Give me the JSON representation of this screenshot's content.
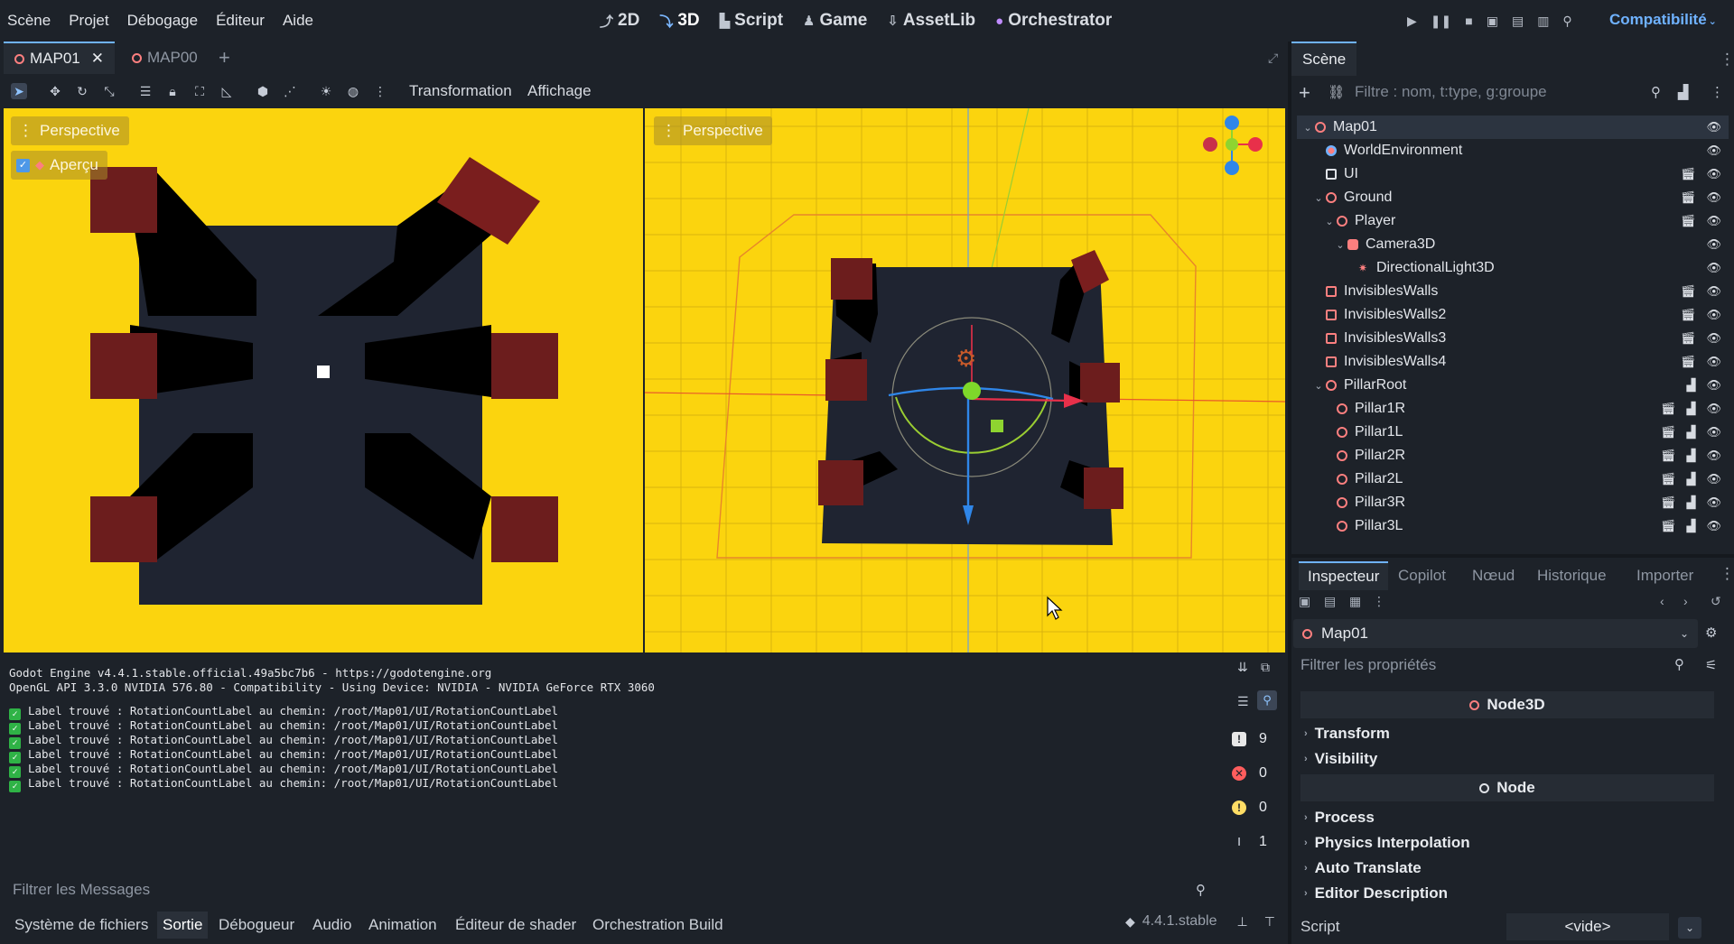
{
  "menu": [
    "Scène",
    "Projet",
    "Débogage",
    "Éditeur",
    "Aide"
  ],
  "workspaces": [
    {
      "label": "2D",
      "icon": "2d-icon"
    },
    {
      "label": "3D",
      "icon": "3d-icon"
    },
    {
      "label": "Script",
      "icon": "script-icon"
    },
    {
      "label": "Game",
      "icon": "game-icon"
    },
    {
      "label": "AssetLib",
      "icon": "assetlib-icon"
    },
    {
      "label": "Orchestrator",
      "icon": "orchestrator-icon"
    }
  ],
  "active_workspace": "3D",
  "renderer": "Compatibilité",
  "editor_tabs": [
    {
      "label": "MAP01",
      "active": true
    },
    {
      "label": "MAP00",
      "active": false
    }
  ],
  "viewport_toolbar": {
    "transform_label": "Transformation",
    "view_label": "Affichage"
  },
  "viewports": {
    "left": {
      "mode": "Perspective",
      "preview_label": "Aperçu",
      "preview_checked": true
    },
    "right": {
      "mode": "Perspective"
    }
  },
  "output": {
    "lines": [
      "Godot Engine v4.4.1.stable.official.49a5bc7b6 - https://godotengine.org",
      "OpenGL API 3.3.0 NVIDIA 576.80 - Compatibility - Using Device: NVIDIA - NVIDIA GeForce RTX 3060"
    ],
    "label_lines": [
      "Label trouvé : RotationCountLabel au chemin: /root/Map01/UI/RotationCountLabel",
      "Label trouvé : RotationCountLabel au chemin: /root/Map01/UI/RotationCountLabel",
      "Label trouvé : RotationCountLabel au chemin: /root/Map01/UI/RotationCountLabel",
      "Label trouvé : RotationCountLabel au chemin: /root/Map01/UI/RotationCountLabel",
      "Label trouvé : RotationCountLabel au chemin: /root/Map01/UI/RotationCountLabel",
      "Label trouvé : RotationCountLabel au chemin: /root/Map01/UI/RotationCountLabel"
    ],
    "counts": {
      "messages": "9",
      "errors": "0",
      "warnings": "0",
      "editor": "1"
    },
    "filter_placeholder": "Filtrer les Messages"
  },
  "bottom_tabs": [
    "Système de fichiers",
    "Sortie",
    "Débogueur",
    "Audio",
    "Animation",
    "Éditeur de shader",
    "Orchestration Build"
  ],
  "active_bottom_tab": "Sortie",
  "version": "4.4.1.stable",
  "scene_dock": {
    "title": "Scène",
    "filter_placeholder": "Filtre : nom, t:type, g:groupe",
    "nodes": [
      {
        "name": "Map01",
        "depth": 0,
        "arrow": "v",
        "icon": "node3d-icon",
        "color": "#fc7f7f",
        "extra": []
      },
      {
        "name": "WorldEnvironment",
        "depth": 1,
        "arrow": "",
        "icon": "world-environment-icon",
        "color": "#fc7f7f",
        "extra": []
      },
      {
        "name": "UI",
        "depth": 1,
        "arrow": "",
        "icon": "control-icon",
        "color": "#8eef97",
        "extra": [
          "clapper-icon"
        ]
      },
      {
        "name": "Ground",
        "depth": 1,
        "arrow": "v",
        "icon": "node3d-icon",
        "color": "#fc7f7f",
        "extra": [
          "clapper-icon"
        ]
      },
      {
        "name": "Player",
        "depth": 2,
        "arrow": "v",
        "icon": "node3d-icon",
        "color": "#fc7f7f",
        "extra": [
          "clapper-icon"
        ]
      },
      {
        "name": "Camera3D",
        "depth": 3,
        "arrow": "v",
        "icon": "camera3d-icon",
        "color": "#fc7f7f",
        "extra": []
      },
      {
        "name": "DirectionalLight3D",
        "depth": 4,
        "arrow": "",
        "icon": "light-icon",
        "color": "#fc7f7f",
        "extra": []
      },
      {
        "name": "InvisiblesWalls",
        "depth": 1,
        "arrow": "",
        "icon": "staticbody-icon",
        "color": "#fc7f7f",
        "extra": [
          "clapper-icon"
        ]
      },
      {
        "name": "InvisiblesWalls2",
        "depth": 1,
        "arrow": "",
        "icon": "staticbody-icon",
        "color": "#fc7f7f",
        "extra": [
          "clapper-icon"
        ]
      },
      {
        "name": "InvisiblesWalls3",
        "depth": 1,
        "arrow": "",
        "icon": "staticbody-icon",
        "color": "#fc7f7f",
        "extra": [
          "clapper-icon"
        ]
      },
      {
        "name": "InvisiblesWalls4",
        "depth": 1,
        "arrow": "",
        "icon": "staticbody-icon",
        "color": "#fc7f7f",
        "extra": [
          "clapper-icon"
        ]
      },
      {
        "name": "PillarRoot",
        "depth": 1,
        "arrow": "v",
        "icon": "node3d-icon",
        "color": "#fc7f7f",
        "extra": [
          "script-icon"
        ]
      },
      {
        "name": "Pillar1R",
        "depth": 2,
        "arrow": "",
        "icon": "node3d-icon",
        "color": "#fc7f7f",
        "extra": [
          "clapper-icon",
          "script-icon"
        ]
      },
      {
        "name": "Pillar1L",
        "depth": 2,
        "arrow": "",
        "icon": "node3d-icon",
        "color": "#fc7f7f",
        "extra": [
          "clapper-icon",
          "script-icon"
        ]
      },
      {
        "name": "Pillar2R",
        "depth": 2,
        "arrow": "",
        "icon": "node3d-icon",
        "color": "#fc7f7f",
        "extra": [
          "clapper-icon",
          "script-icon"
        ]
      },
      {
        "name": "Pillar2L",
        "depth": 2,
        "arrow": "",
        "icon": "node3d-icon",
        "color": "#fc7f7f",
        "extra": [
          "clapper-icon",
          "script-icon"
        ]
      },
      {
        "name": "Pillar3R",
        "depth": 2,
        "arrow": "",
        "icon": "node3d-icon",
        "color": "#fc7f7f",
        "extra": [
          "clapper-icon",
          "script-icon"
        ]
      },
      {
        "name": "Pillar3L",
        "depth": 2,
        "arrow": "",
        "icon": "node3d-icon",
        "color": "#fc7f7f",
        "extra": [
          "clapper-icon",
          "script-icon"
        ]
      }
    ]
  },
  "inspector": {
    "tabs": [
      "Inspecteur",
      "Copilot",
      "Nœud",
      "Historique",
      "Importer"
    ],
    "active_tab": "Inspecteur",
    "object": "Map01",
    "filter_placeholder": "Filtrer les propriétés",
    "class1": "Node3D",
    "sections1": [
      "Transform",
      "Visibility"
    ],
    "class2": "Node",
    "sections2": [
      "Process",
      "Physics Interpolation",
      "Auto Translate",
      "Editor Description"
    ],
    "script_label": "Script",
    "script_value": "<vide>"
  },
  "colors": {
    "accent": "#6fb2ff",
    "viewport_bg": "#fbd40e",
    "pillar": "#7a1d1d",
    "ground": "#1f2431",
    "node3d": "#fc7f7f"
  }
}
